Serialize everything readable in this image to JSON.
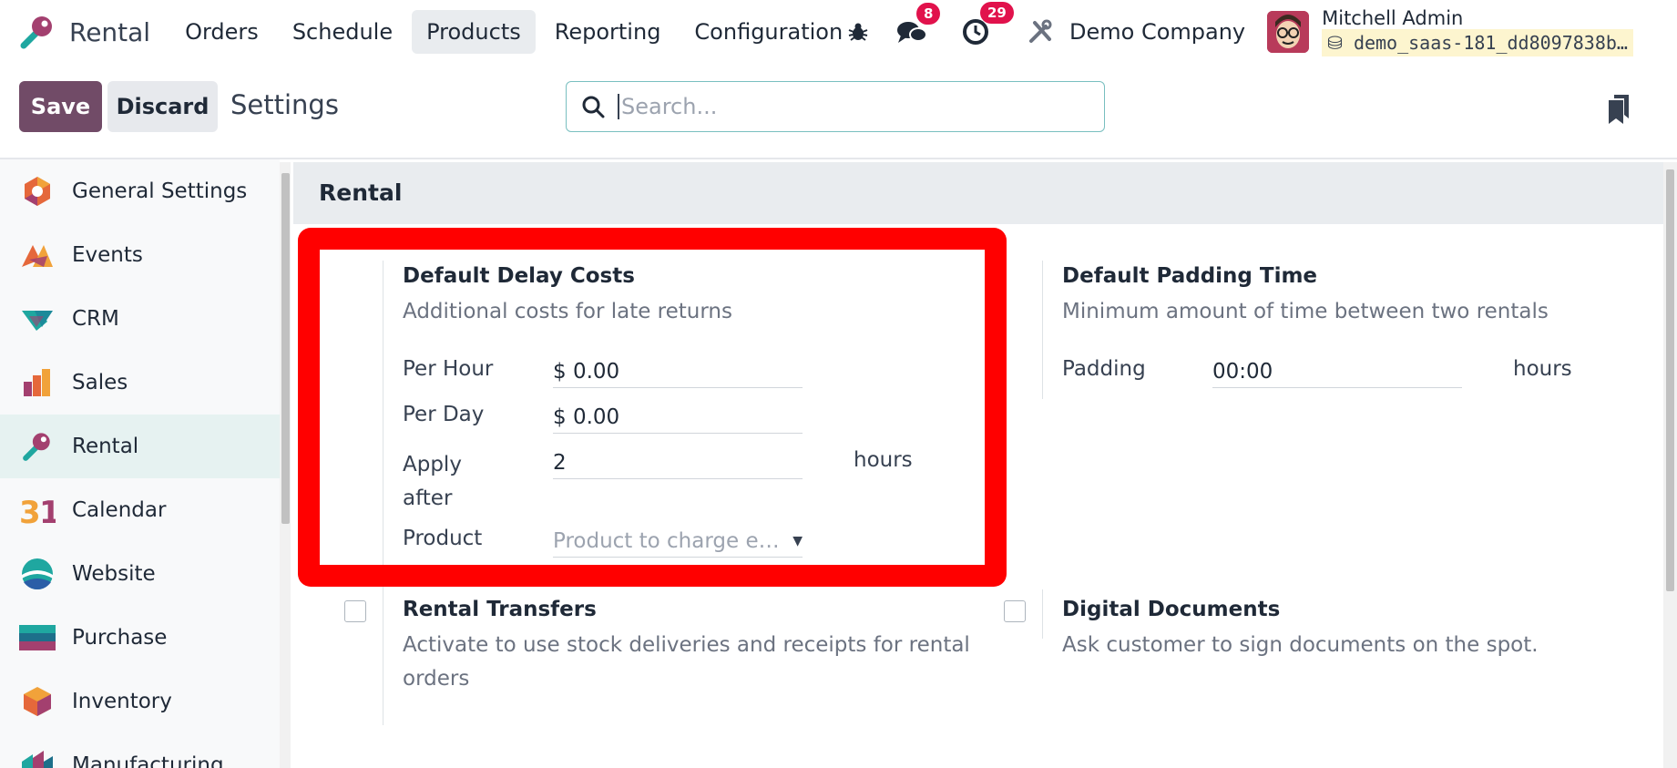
{
  "navbar": {
    "app_name": "Rental",
    "menu": [
      "Orders",
      "Schedule",
      "Products",
      "Reporting",
      "Configuration"
    ],
    "active_menu": "Products",
    "messages_count": "8",
    "activities_count": "29",
    "company": "Demo Company",
    "user_name": "Mitchell Admin",
    "database": "demo_saas-181_dd8097838b…"
  },
  "control": {
    "save_label": "Save",
    "discard_label": "Discard",
    "breadcrumb": "Settings",
    "search_placeholder": "Search..."
  },
  "sidebar": {
    "items": [
      {
        "label": "General Settings",
        "icon": "general-settings-icon"
      },
      {
        "label": "Events",
        "icon": "events-icon"
      },
      {
        "label": "CRM",
        "icon": "crm-icon"
      },
      {
        "label": "Sales",
        "icon": "sales-icon"
      },
      {
        "label": "Rental",
        "icon": "rental-icon",
        "active": true
      },
      {
        "label": "Calendar",
        "icon": "calendar-icon"
      },
      {
        "label": "Website",
        "icon": "website-icon"
      },
      {
        "label": "Purchase",
        "icon": "purchase-icon"
      },
      {
        "label": "Inventory",
        "icon": "inventory-icon"
      },
      {
        "label": "Manufacturing",
        "icon": "manufacturing-icon"
      }
    ]
  },
  "section": {
    "title": "Rental"
  },
  "delay_costs": {
    "title": "Default Delay Costs",
    "description": "Additional costs for late returns",
    "per_hour_label": "Per Hour",
    "per_hour_value": "$ 0.00",
    "per_day_label": "Per Day",
    "per_day_value": "$ 0.00",
    "apply_after_label_1": "Apply",
    "apply_after_label_2": "after",
    "apply_after_value": "2",
    "apply_after_unit": "hours",
    "product_label": "Product",
    "product_placeholder": "Product to charge e…"
  },
  "padding": {
    "title": "Default Padding Time",
    "description": "Minimum amount of time between two rentals",
    "label": "Padding",
    "value": "00:00",
    "unit": "hours"
  },
  "transfers": {
    "title": "Rental Transfers",
    "description_1": "Activate to use stock deliveries and receipts for rental",
    "description_2": "orders",
    "checked": false
  },
  "digital_docs": {
    "title": "Digital Documents",
    "description": "Ask customer to sign documents on the spot.",
    "checked": false
  },
  "colors": {
    "primary": "#714b67",
    "highlight": "#ff0000",
    "badge": "#e1124c"
  }
}
